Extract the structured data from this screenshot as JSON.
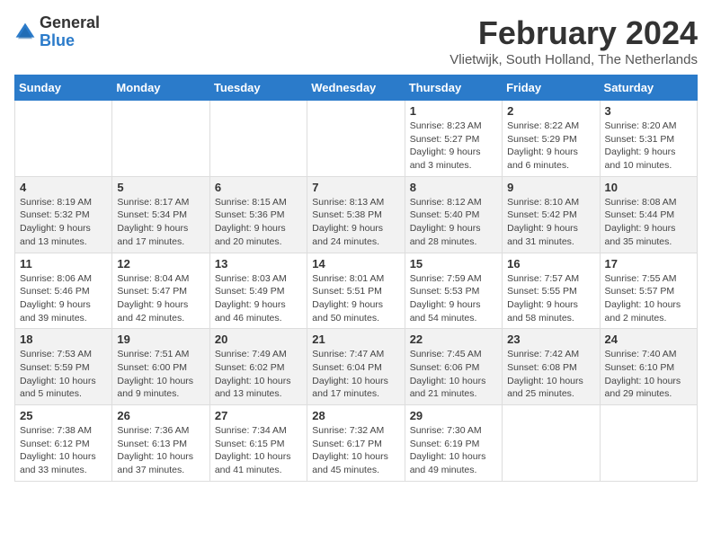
{
  "logo": {
    "general": "General",
    "blue": "Blue"
  },
  "title": "February 2024",
  "location": "Vlietwijk, South Holland, The Netherlands",
  "days_of_week": [
    "Sunday",
    "Monday",
    "Tuesday",
    "Wednesday",
    "Thursday",
    "Friday",
    "Saturday"
  ],
  "weeks": [
    [
      {
        "day": "",
        "info": ""
      },
      {
        "day": "",
        "info": ""
      },
      {
        "day": "",
        "info": ""
      },
      {
        "day": "",
        "info": ""
      },
      {
        "day": "1",
        "info": "Sunrise: 8:23 AM\nSunset: 5:27 PM\nDaylight: 9 hours and 3 minutes."
      },
      {
        "day": "2",
        "info": "Sunrise: 8:22 AM\nSunset: 5:29 PM\nDaylight: 9 hours and 6 minutes."
      },
      {
        "day": "3",
        "info": "Sunrise: 8:20 AM\nSunset: 5:31 PM\nDaylight: 9 hours and 10 minutes."
      }
    ],
    [
      {
        "day": "4",
        "info": "Sunrise: 8:19 AM\nSunset: 5:32 PM\nDaylight: 9 hours and 13 minutes."
      },
      {
        "day": "5",
        "info": "Sunrise: 8:17 AM\nSunset: 5:34 PM\nDaylight: 9 hours and 17 minutes."
      },
      {
        "day": "6",
        "info": "Sunrise: 8:15 AM\nSunset: 5:36 PM\nDaylight: 9 hours and 20 minutes."
      },
      {
        "day": "7",
        "info": "Sunrise: 8:13 AM\nSunset: 5:38 PM\nDaylight: 9 hours and 24 minutes."
      },
      {
        "day": "8",
        "info": "Sunrise: 8:12 AM\nSunset: 5:40 PM\nDaylight: 9 hours and 28 minutes."
      },
      {
        "day": "9",
        "info": "Sunrise: 8:10 AM\nSunset: 5:42 PM\nDaylight: 9 hours and 31 minutes."
      },
      {
        "day": "10",
        "info": "Sunrise: 8:08 AM\nSunset: 5:44 PM\nDaylight: 9 hours and 35 minutes."
      }
    ],
    [
      {
        "day": "11",
        "info": "Sunrise: 8:06 AM\nSunset: 5:46 PM\nDaylight: 9 hours and 39 minutes."
      },
      {
        "day": "12",
        "info": "Sunrise: 8:04 AM\nSunset: 5:47 PM\nDaylight: 9 hours and 42 minutes."
      },
      {
        "day": "13",
        "info": "Sunrise: 8:03 AM\nSunset: 5:49 PM\nDaylight: 9 hours and 46 minutes."
      },
      {
        "day": "14",
        "info": "Sunrise: 8:01 AM\nSunset: 5:51 PM\nDaylight: 9 hours and 50 minutes."
      },
      {
        "day": "15",
        "info": "Sunrise: 7:59 AM\nSunset: 5:53 PM\nDaylight: 9 hours and 54 minutes."
      },
      {
        "day": "16",
        "info": "Sunrise: 7:57 AM\nSunset: 5:55 PM\nDaylight: 9 hours and 58 minutes."
      },
      {
        "day": "17",
        "info": "Sunrise: 7:55 AM\nSunset: 5:57 PM\nDaylight: 10 hours and 2 minutes."
      }
    ],
    [
      {
        "day": "18",
        "info": "Sunrise: 7:53 AM\nSunset: 5:59 PM\nDaylight: 10 hours and 5 minutes."
      },
      {
        "day": "19",
        "info": "Sunrise: 7:51 AM\nSunset: 6:00 PM\nDaylight: 10 hours and 9 minutes."
      },
      {
        "day": "20",
        "info": "Sunrise: 7:49 AM\nSunset: 6:02 PM\nDaylight: 10 hours and 13 minutes."
      },
      {
        "day": "21",
        "info": "Sunrise: 7:47 AM\nSunset: 6:04 PM\nDaylight: 10 hours and 17 minutes."
      },
      {
        "day": "22",
        "info": "Sunrise: 7:45 AM\nSunset: 6:06 PM\nDaylight: 10 hours and 21 minutes."
      },
      {
        "day": "23",
        "info": "Sunrise: 7:42 AM\nSunset: 6:08 PM\nDaylight: 10 hours and 25 minutes."
      },
      {
        "day": "24",
        "info": "Sunrise: 7:40 AM\nSunset: 6:10 PM\nDaylight: 10 hours and 29 minutes."
      }
    ],
    [
      {
        "day": "25",
        "info": "Sunrise: 7:38 AM\nSunset: 6:12 PM\nDaylight: 10 hours and 33 minutes."
      },
      {
        "day": "26",
        "info": "Sunrise: 7:36 AM\nSunset: 6:13 PM\nDaylight: 10 hours and 37 minutes."
      },
      {
        "day": "27",
        "info": "Sunrise: 7:34 AM\nSunset: 6:15 PM\nDaylight: 10 hours and 41 minutes."
      },
      {
        "day": "28",
        "info": "Sunrise: 7:32 AM\nSunset: 6:17 PM\nDaylight: 10 hours and 45 minutes."
      },
      {
        "day": "29",
        "info": "Sunrise: 7:30 AM\nSunset: 6:19 PM\nDaylight: 10 hours and 49 minutes."
      },
      {
        "day": "",
        "info": ""
      },
      {
        "day": "",
        "info": ""
      }
    ]
  ]
}
